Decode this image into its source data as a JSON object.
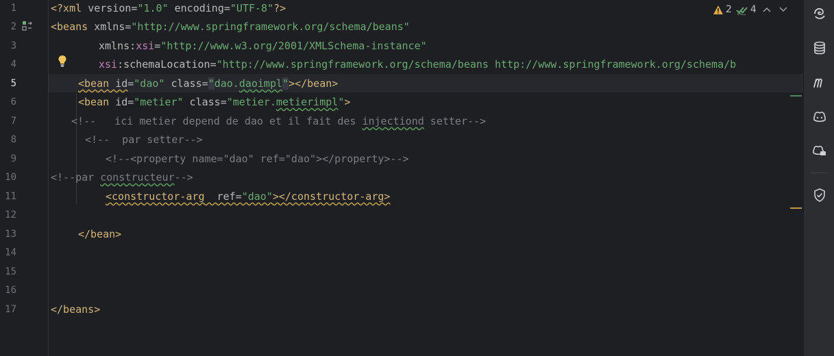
{
  "inspection": {
    "warnings_count": "2",
    "weak_warnings_count": "4",
    "prev_icon": "chevron-up-icon",
    "next_icon": "chevron-down-icon"
  },
  "line_numbers": [
    "1",
    "2",
    "3",
    "4",
    "5",
    "6",
    "7",
    "8",
    "9",
    "10",
    "11",
    "12",
    "13",
    "14",
    "15",
    "16",
    "17"
  ],
  "active_line": "5",
  "code": {
    "l1": {
      "t1": "<?xml ",
      "a1": "version",
      "eq1": "=",
      "v1": "\"1.0\"",
      "a2": " encoding",
      "eq2": "=",
      "v2": "\"UTF-8\"",
      "t2": "?>"
    },
    "l2": {
      "t1": "<beans ",
      "a1": "xmlns",
      "eq1": "=",
      "v1": "\"http://www.springframework.org/schema/beans\""
    },
    "l3": {
      "a1": "xmlns:",
      "ns": "xsi",
      "eq1": "=",
      "v1": "\"http://www.w3.org/2001/XMLSchema-instance\""
    },
    "l4": {
      "ns": "xsi",
      "a1": ":schemaLocation",
      "eq1": "=",
      "v1": "\"http://www.springframework.org/schema/beans http://www.springframework.org/schema/b"
    },
    "l5": {
      "t1": "<bean ",
      "a1": "id",
      "eq1": "=",
      "v1": "\"dao\"",
      "a2": " class",
      "eq2": "=",
      "v2a": "\"",
      "v2b": "dao.",
      "v2c": "daoimpl",
      "v2d": "\"",
      "t2": "></bean>"
    },
    "l6": {
      "t1": "<bean ",
      "a1": "id",
      "eq1": "=",
      "v1": "\"metier\"",
      "a2": " class",
      "eq2": "=",
      "v2a": "\"metier.",
      "v2b": "metierimpl",
      "v2c": "\"",
      "t2": ">"
    },
    "l7": {
      "c1": "<!--   ici metier depend de dao et il fait des ",
      "c2": "injectiond",
      "c3": " setter-->"
    },
    "l8": {
      "c1": "<!--  par setter-->"
    },
    "l9": {
      "c1": "<!--<property name=\"dao\" ref=\"dao\"></property>-->"
    },
    "l10": {
      "c1": "<!--par ",
      "c2": "constructeur",
      "c3": "-->"
    },
    "l11": {
      "t1": "<constructor-arg",
      "a1": "  ref",
      "eq1": "=",
      "v1": "\"dao\"",
      "t2": "></constructor-arg>"
    },
    "l13": {
      "t1": "</bean>"
    },
    "l17": {
      "t1": "</beans>"
    }
  },
  "right_toolbar": [
    "ai-assistant-icon",
    "database-icon",
    "maven-icon",
    "copilot-icon",
    "copilot-chat-icon",
    "security-shield-icon"
  ],
  "colors": {
    "tag": "#d5b778",
    "value": "#6aab73",
    "comment": "#7a7e85",
    "namespace": "#c77dbb",
    "warning": "#e0a846",
    "weak_warning": "#6aab73"
  }
}
